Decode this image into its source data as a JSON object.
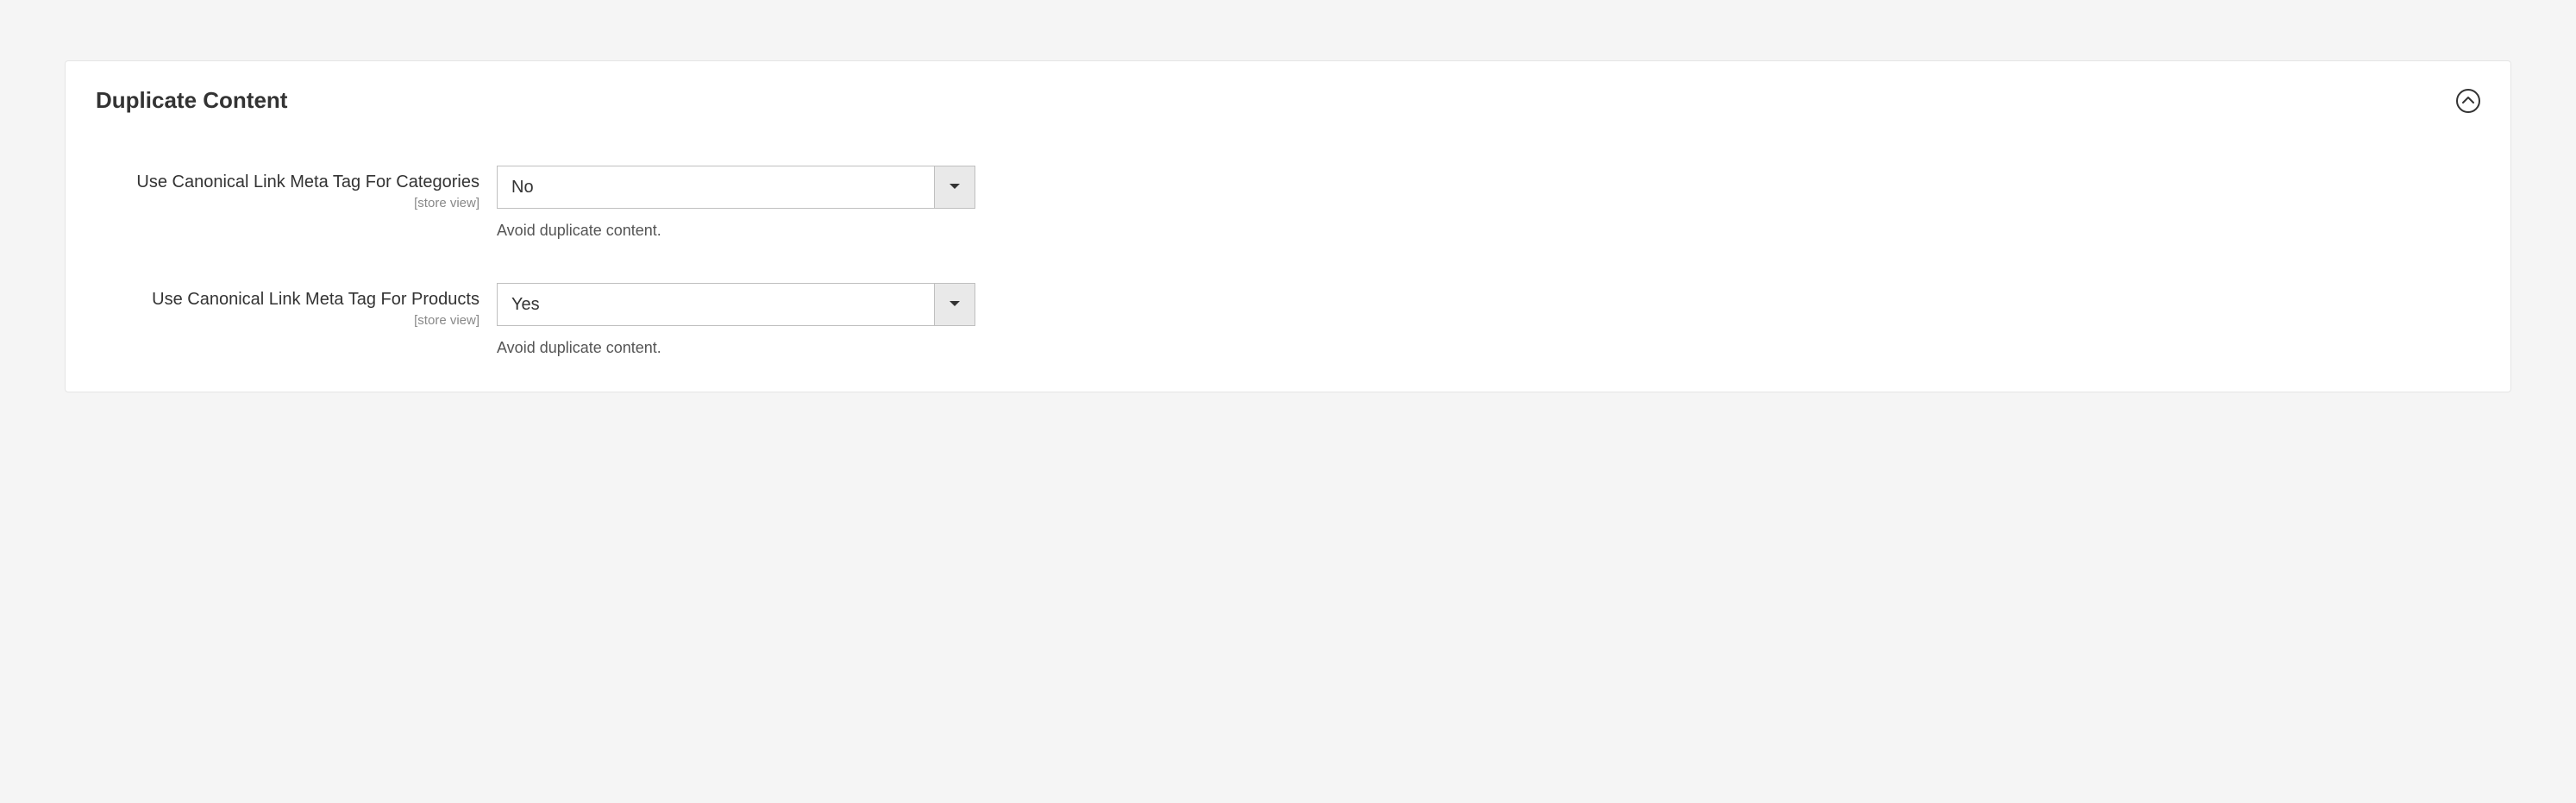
{
  "section": {
    "title": "Duplicate Content"
  },
  "fields": {
    "categories": {
      "label": "Use Canonical Link Meta Tag For Categories",
      "scope": "[store view]",
      "value": "No",
      "comment": "Avoid duplicate content."
    },
    "products": {
      "label": "Use Canonical Link Meta Tag For Products",
      "scope": "[store view]",
      "value": "Yes",
      "comment": "Avoid duplicate content."
    }
  }
}
